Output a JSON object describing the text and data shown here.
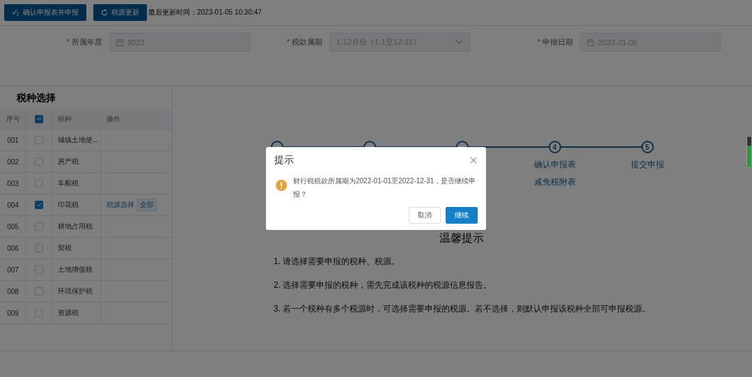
{
  "toolbar": {
    "buttons": [
      {
        "label": "确认申报表并申报",
        "kind": "confirm"
      },
      {
        "label": "税源更新",
        "kind": "refresh"
      }
    ],
    "last_update": "最后更新时间：2023-01-05 10:30:47"
  },
  "form": {
    "fields": [
      {
        "label": "所属年度",
        "required_mark": "*",
        "kind": "date",
        "value": "2022"
      },
      {
        "label": "税款属期",
        "required_mark": "*",
        "kind": "select",
        "value": "1-12月份（1-1至12-31）"
      },
      {
        "label": "申报日期",
        "required_mark": "*",
        "kind": "date",
        "value": "2023-01-05"
      }
    ]
  },
  "tax_table": {
    "title": "税种选择",
    "columns": [
      "序号",
      "税种",
      "操作"
    ],
    "header_indeterminate": true,
    "rows": [
      {
        "no": "001",
        "name": "城镇土地使...",
        "checked": false
      },
      {
        "no": "002",
        "name": "房产税",
        "checked": false
      },
      {
        "no": "003",
        "name": "车船税",
        "checked": false
      },
      {
        "no": "004",
        "name": "印花税",
        "checked": true,
        "actions": [
          {
            "label": "税源选择",
            "kind": "link"
          },
          {
            "label": "全部",
            "kind": "tag"
          }
        ]
      },
      {
        "no": "005",
        "name": "耕地占用税",
        "checked": false
      },
      {
        "no": "006",
        "name": "契税",
        "checked": false
      },
      {
        "no": "007",
        "name": "土地增值税",
        "checked": false
      },
      {
        "no": "008",
        "name": "环境保护税",
        "checked": false
      },
      {
        "no": "009",
        "name": "资源税",
        "checked": false
      }
    ]
  },
  "steps": [
    {
      "kind": "covered"
    },
    {
      "kind": "covered"
    },
    {
      "kind": "covered"
    },
    {
      "number": "4",
      "labels": [
        "确认申报表",
        "减免税附表"
      ]
    },
    {
      "number": "5",
      "labels": [
        "提交申报"
      ]
    }
  ],
  "tips": {
    "title": "温馨提示",
    "items": [
      "1. 请选择需要申报的税种、税源。",
      "2. 选择需要申报的税种，需先完成该税种的税源信息报告。",
      "3. 若一个税种有多个税源时，可选择需要申报的税源。若不选择，则默认申报该税种全部可申报税源。"
    ]
  },
  "dialog": {
    "title": "提示",
    "kind": "warning",
    "message": "财行税税款所属期为2022-01-01至2022-12-31，是否继续申报？",
    "buttons": [
      {
        "label": "取消",
        "primary": false
      },
      {
        "label": "继续",
        "primary": true
      }
    ]
  }
}
